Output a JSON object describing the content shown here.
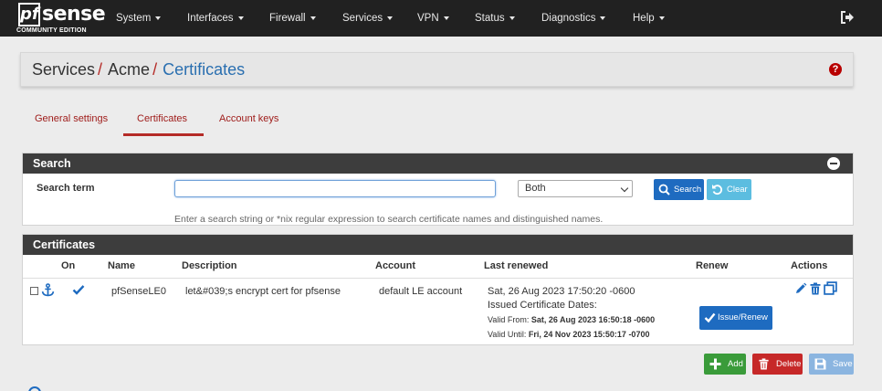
{
  "nav": {
    "logo_text": "sense",
    "logo_pf": "pf",
    "logo_sub": "COMMUNITY EDITION",
    "items": [
      "System",
      "Interfaces",
      "Firewall",
      "Services",
      "VPN",
      "Status",
      "Diagnostics",
      "Help"
    ]
  },
  "breadcrumb": {
    "items": [
      "Services",
      "Acme"
    ],
    "separator": "/",
    "active": "Certificates"
  },
  "help_icon": "?",
  "tabs": [
    "General settings",
    "Certificates",
    "Account keys"
  ],
  "search_panel": {
    "title": "Search",
    "label": "Search term",
    "input_value": "",
    "scope_selected": "Both",
    "search_button": "Search",
    "clear_button": "Clear",
    "hint": "Enter a search string or *nix regular expression to search certificate names and distinguished names."
  },
  "certs_panel": {
    "title": "Certificates",
    "columns": [
      "On",
      "Name",
      "Description",
      "Account",
      "Last renewed",
      "Renew",
      "Actions"
    ],
    "rows": [
      {
        "name": "pfSenseLE0",
        "description": "let&#039;s encrypt cert for pfsense",
        "account": "default LE account",
        "last_renewed": "Sat, 26 Aug 2023 17:50:20 -0600",
        "issued_label": "Issued Certificate Dates:",
        "valid_from_label": "Valid From:",
        "valid_from": "Sat, 26 Aug 2023 16:50:18 -0600",
        "valid_until_label": "Valid Until:",
        "valid_until": "Fri, 24 Nov 2023 15:50:17 -0700",
        "renew_button": "Issue/Renew"
      }
    ]
  },
  "footer_buttons": {
    "add": "Add",
    "delete": "Delete",
    "save": "Save"
  },
  "colors": {
    "navbar": "#212121",
    "accent_red": "#b52b27",
    "primary_blue": "#1e6bc0",
    "info_blue": "#5cbde0",
    "success_green": "#3a9b3a",
    "danger_red": "#c62828"
  }
}
